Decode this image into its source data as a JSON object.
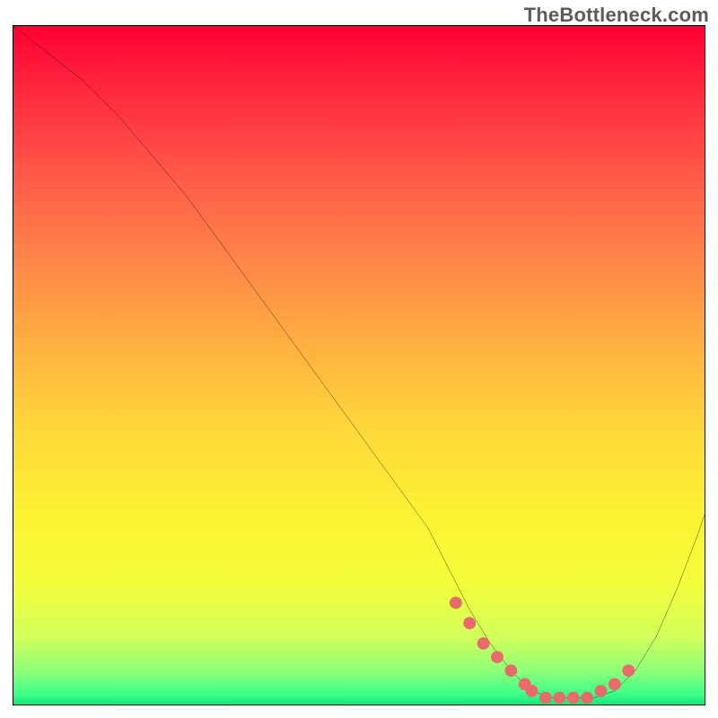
{
  "watermark": "TheBottleneck.com",
  "chart_data": {
    "type": "line",
    "title": "",
    "xlabel": "",
    "ylabel": "",
    "xlim": [
      0,
      100
    ],
    "ylim": [
      0,
      100
    ],
    "series": [
      {
        "name": "bottleneck-curve",
        "x": [
          0,
          5,
          10,
          15,
          20,
          25,
          30,
          35,
          40,
          45,
          50,
          55,
          60,
          63,
          66,
          69,
          72,
          75,
          78,
          81,
          84,
          87,
          90,
          93,
          96,
          99,
          100
        ],
        "values": [
          100,
          96,
          92,
          87,
          81,
          75,
          68,
          61,
          54,
          47,
          40,
          33,
          26,
          20,
          14,
          9,
          5,
          2,
          1,
          1,
          1,
          2,
          5,
          10,
          17,
          25,
          28
        ]
      }
    ],
    "annotations": [
      {
        "name": "sweet-spot-dots",
        "style": "dotted-red",
        "x": [
          64,
          66,
          68,
          70,
          72,
          74,
          75,
          77,
          79,
          81,
          83,
          85,
          87,
          89
        ],
        "values": [
          15,
          12,
          9,
          7,
          5,
          3,
          2,
          1,
          1,
          1,
          1,
          2,
          3,
          5
        ]
      }
    ],
    "background_gradient": {
      "stops": [
        {
          "offset": 0.0,
          "color": "#ff0033"
        },
        {
          "offset": 0.1,
          "color": "#ff2a3f"
        },
        {
          "offset": 0.22,
          "color": "#ff5948"
        },
        {
          "offset": 0.35,
          "color": "#ff8749"
        },
        {
          "offset": 0.48,
          "color": "#ffb340"
        },
        {
          "offset": 0.6,
          "color": "#ffd93a"
        },
        {
          "offset": 0.72,
          "color": "#fcf233"
        },
        {
          "offset": 0.82,
          "color": "#f4fd3a"
        },
        {
          "offset": 0.9,
          "color": "#d2ff5a"
        },
        {
          "offset": 0.95,
          "color": "#8fff78"
        },
        {
          "offset": 0.985,
          "color": "#3bff88"
        },
        {
          "offset": 1.0,
          "color": "#17e67a"
        }
      ]
    }
  }
}
